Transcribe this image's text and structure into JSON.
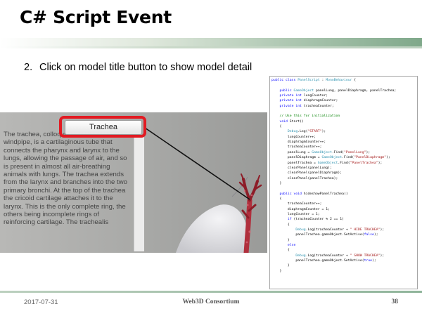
{
  "slide": {
    "title": "C# Script Event",
    "bullet_number": "2.",
    "bullet_text": "Click on model title button to show model detail"
  },
  "scene": {
    "button_label": "Trachea",
    "description": "The trachea, colloquially called the windpipe, is a cartilaginous tube that connects the pharynx and larynx to the lungs, allowing the passage of air, and so is present in almost all air-breathing animals with lungs. The trachea extends from the larynx and branches into the two primary bronchi. At the top of the trachea the cricoid cartilage attaches it to the larynx. This is the only complete ring, the others being incomplete rings of reinforcing cartilage. The trachealis",
    "highlight_color": "#e21a22"
  },
  "code": {
    "lines": [
      [
        {
          "c": "k",
          "v": "public class "
        },
        {
          "c": "t",
          "v": "PanelScript"
        },
        {
          "c": "p",
          "v": " : "
        },
        {
          "c": "t",
          "v": "MonoBehaviour"
        },
        {
          "c": "p",
          "v": " {"
        }
      ],
      [
        {
          "c": "p",
          "v": ""
        }
      ],
      [
        {
          "c": "p",
          "v": "    "
        },
        {
          "c": "k",
          "v": "public "
        },
        {
          "c": "t",
          "v": "GameObject"
        },
        {
          "c": "p",
          "v": " panelLung, panelDiaphragm, panelTrachea;"
        }
      ],
      [
        {
          "c": "p",
          "v": "    "
        },
        {
          "c": "k",
          "v": "private int "
        },
        {
          "c": "p",
          "v": "lungCounter;"
        }
      ],
      [
        {
          "c": "p",
          "v": "    "
        },
        {
          "c": "k",
          "v": "private int "
        },
        {
          "c": "p",
          "v": "diaphragmCounter;"
        }
      ],
      [
        {
          "c": "p",
          "v": "    "
        },
        {
          "c": "k",
          "v": "private int "
        },
        {
          "c": "p",
          "v": "tracheaCounter;"
        }
      ],
      [
        {
          "c": "p",
          "v": ""
        }
      ],
      [
        {
          "c": "p",
          "v": "    "
        },
        {
          "c": "c",
          "v": "// Use this for initialization"
        }
      ],
      [
        {
          "c": "p",
          "v": "    "
        },
        {
          "c": "k",
          "v": "void "
        },
        {
          "c": "p",
          "v": "Start()"
        }
      ],
      [
        {
          "c": "p",
          "v": "    {"
        }
      ],
      [
        {
          "c": "p",
          "v": "        "
        },
        {
          "c": "t",
          "v": "Debug"
        },
        {
          "c": "p",
          "v": ".Log("
        },
        {
          "c": "s",
          "v": "\"START\""
        },
        {
          "c": "p",
          "v": ");"
        }
      ],
      [
        {
          "c": "p",
          "v": "        lungCounter++;"
        }
      ],
      [
        {
          "c": "p",
          "v": "        diaphragmCounter++;"
        }
      ],
      [
        {
          "c": "p",
          "v": "        tracheaCounter++;"
        }
      ],
      [
        {
          "c": "p",
          "v": "        panelLung = "
        },
        {
          "c": "t",
          "v": "GameObject"
        },
        {
          "c": "p",
          "v": ".Find("
        },
        {
          "c": "s",
          "v": "\"PanelLung\""
        },
        {
          "c": "p",
          "v": ");"
        }
      ],
      [
        {
          "c": "p",
          "v": "        panelDiaphragm = "
        },
        {
          "c": "t",
          "v": "GameObject"
        },
        {
          "c": "p",
          "v": ".Find("
        },
        {
          "c": "s",
          "v": "\"PanelDiaphragm\""
        },
        {
          "c": "p",
          "v": ");"
        }
      ],
      [
        {
          "c": "p",
          "v": "        panelTrachea = "
        },
        {
          "c": "t",
          "v": "GameObject"
        },
        {
          "c": "p",
          "v": ".Find("
        },
        {
          "c": "s",
          "v": "\"PanelTrachea\""
        },
        {
          "c": "p",
          "v": ");"
        }
      ],
      [
        {
          "c": "p",
          "v": "        clearPanel(panelLung);"
        }
      ],
      [
        {
          "c": "p",
          "v": "        clearPanel(panelDiaphragm);"
        }
      ],
      [
        {
          "c": "p",
          "v": "        clearPanel(panelTrachea);"
        }
      ],
      [
        {
          "c": "p",
          "v": "    }"
        }
      ],
      [
        {
          "c": "p",
          "v": ""
        }
      ],
      [
        {
          "c": "p",
          "v": "    "
        },
        {
          "c": "k",
          "v": "public void "
        },
        {
          "c": "p",
          "v": "hideshowPanelTrachea()"
        }
      ],
      [
        {
          "c": "p",
          "v": "    {"
        }
      ],
      [
        {
          "c": "p",
          "v": "        tracheaCounter++;"
        }
      ],
      [
        {
          "c": "p",
          "v": "        diaphragmCounter = 1;"
        }
      ],
      [
        {
          "c": "p",
          "v": "        lungCounter = 1;"
        }
      ],
      [
        {
          "c": "p",
          "v": "        "
        },
        {
          "c": "k",
          "v": "if "
        },
        {
          "c": "p",
          "v": "(tracheaCounter % 2 == 1)"
        }
      ],
      [
        {
          "c": "p",
          "v": "        {"
        }
      ],
      [
        {
          "c": "p",
          "v": "            "
        },
        {
          "c": "t",
          "v": "Debug"
        },
        {
          "c": "p",
          "v": ".Log(tracheaCounter + "
        },
        {
          "c": "s",
          "v": "\" HIDE TRACHEA\""
        },
        {
          "c": "p",
          "v": ");"
        }
      ],
      [
        {
          "c": "p",
          "v": "            panelTrachea.gameObject.SetActive("
        },
        {
          "c": "k",
          "v": "false"
        },
        {
          "c": "p",
          "v": ");"
        }
      ],
      [
        {
          "c": "p",
          "v": "        }"
        }
      ],
      [
        {
          "c": "p",
          "v": "        "
        },
        {
          "c": "k",
          "v": "else"
        }
      ],
      [
        {
          "c": "p",
          "v": "        {"
        }
      ],
      [
        {
          "c": "p",
          "v": "            "
        },
        {
          "c": "t",
          "v": "Debug"
        },
        {
          "c": "p",
          "v": ".Log(tracheaCounter + "
        },
        {
          "c": "s",
          "v": "\" SHOW TRACHEA\""
        },
        {
          "c": "p",
          "v": ");"
        }
      ],
      [
        {
          "c": "p",
          "v": "            panelTrachea.gameObject.SetActive("
        },
        {
          "c": "k",
          "v": "true"
        },
        {
          "c": "p",
          "v": ");"
        }
      ],
      [
        {
          "c": "p",
          "v": "        }"
        }
      ],
      [
        {
          "c": "p",
          "v": "    }"
        }
      ]
    ]
  },
  "footer": {
    "date": "2017-07-31",
    "organization": "Web3D Consortium",
    "page_number": "38"
  }
}
